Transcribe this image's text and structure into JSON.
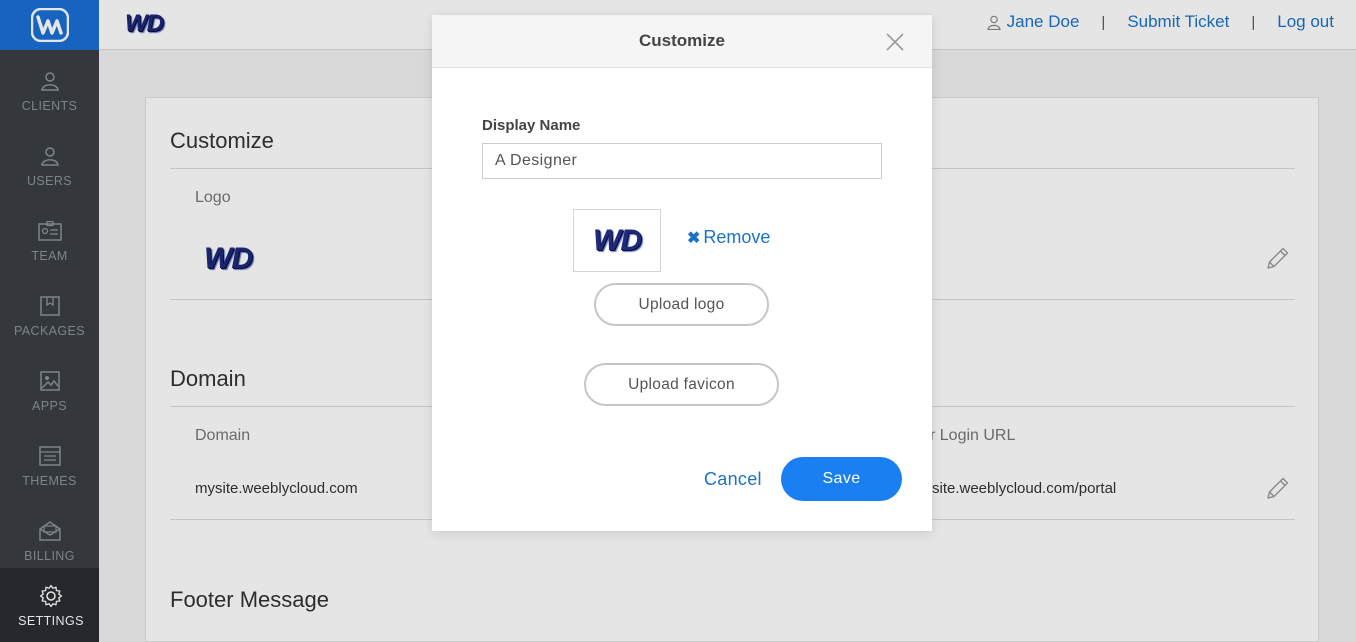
{
  "topbar": {
    "logo_text": "WD",
    "user_name": "Jane Doe",
    "separator": "|",
    "submit_ticket": "Submit Ticket",
    "log_out": "Log out"
  },
  "sidebar": {
    "items": [
      {
        "label": "CLIENTS",
        "icon": "person-icon"
      },
      {
        "label": "USERS",
        "icon": "person-icon"
      },
      {
        "label": "TEAM",
        "icon": "id-card-icon"
      },
      {
        "label": "PACKAGES",
        "icon": "package-icon"
      },
      {
        "label": "APPS",
        "icon": "image-icon"
      },
      {
        "label": "THEMES",
        "icon": "list-icon"
      },
      {
        "label": "BILLING",
        "icon": "envelope-icon"
      },
      {
        "label": "SETTINGS",
        "icon": "gear-icon",
        "active": true
      }
    ]
  },
  "main": {
    "customize_title": "Customize",
    "logo_label": "Logo",
    "logo_text": "WD",
    "domain_title": "Domain",
    "domain_label": "Domain",
    "domain_value": "mysite.weeblycloud.com",
    "login_url_label": "r Login URL",
    "login_url_value": "site.weeblycloud.com/portal",
    "footer_title": "Footer Message"
  },
  "modal": {
    "title": "Customize",
    "display_name_label": "Display Name",
    "display_name_value": "A Designer",
    "logo_text": "WD",
    "remove_label": "Remove",
    "remove_symbol": "✖",
    "upload_logo": "Upload logo",
    "upload_favicon": "Upload favicon",
    "cancel": "Cancel",
    "save": "Save"
  },
  "colors": {
    "brand_blue": "#1a6fd6",
    "link_blue": "#1a73c8",
    "save_blue": "#1a7ff0",
    "sidebar_bg": "#3a3f44"
  }
}
